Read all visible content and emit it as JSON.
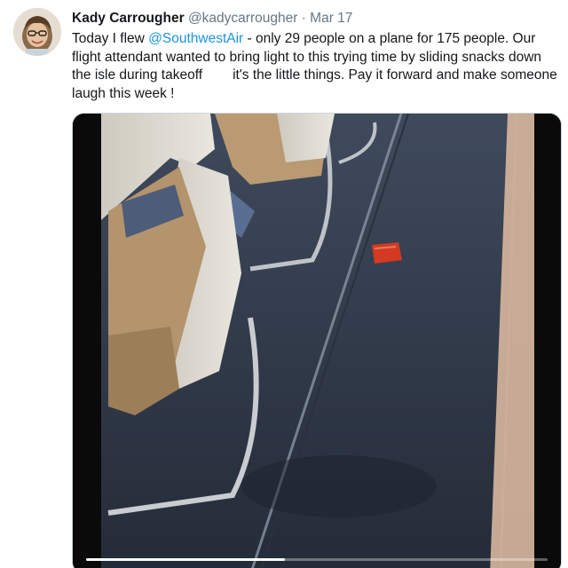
{
  "tweet": {
    "author_name": "Kady Carrougher",
    "author_handle": "@kadycarrougher",
    "separator": "·",
    "date": "Mar 17",
    "text_part1": "Today I flew ",
    "mention": "@SouthwestAir",
    "text_part2": " - only 29 people on a plane for 175 people. Our flight attendant wanted to bring light to this trying time by sliding snacks down the isle during takeoff",
    "text_part3": "it's the little things. Pay it forward and make someone laugh this week !"
  },
  "media": {
    "type": "video",
    "progress_fraction": 0.43
  },
  "colors": {
    "link": "#1b95e0",
    "secondary_text": "#657786",
    "primary_text": "#14171a"
  }
}
